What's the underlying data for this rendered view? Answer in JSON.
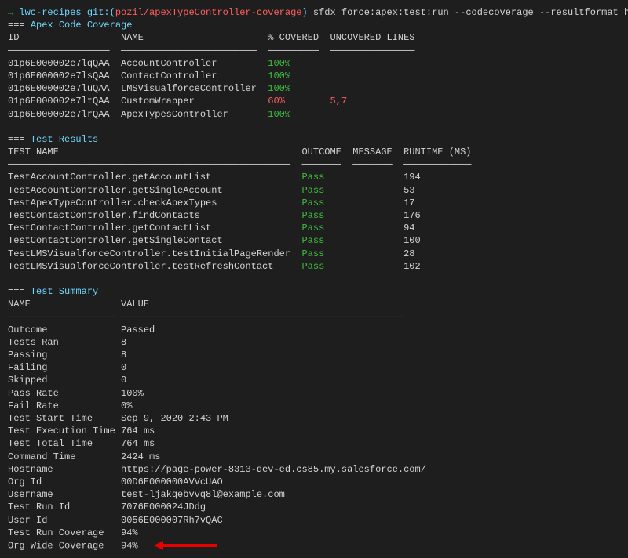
{
  "prompt": {
    "arrow": "→",
    "repo": "lwc-recipes",
    "git_label": "git:(",
    "branch": "pozil/apexTypeController-coverage",
    "close_paren": ")",
    "command": "sfdx force:apex:test:run --codecoverage --resultformat human"
  },
  "coverage": {
    "marker": "===",
    "title": "Apex Code Coverage",
    "headers": {
      "id": "ID",
      "name": "NAME",
      "covered": "% COVERED",
      "uncovered": "UNCOVERED LINES"
    },
    "rows": [
      {
        "id": "01p6E000002e7lqQAA",
        "name": "AccountController",
        "covered": "100%",
        "uncovered": "",
        "cls": "green"
      },
      {
        "id": "01p6E000002e7lsQAA",
        "name": "ContactController",
        "covered": "100%",
        "uncovered": "",
        "cls": "green"
      },
      {
        "id": "01p6E000002e7luQAA",
        "name": "LMSVisualforceController",
        "covered": "100%",
        "uncovered": "",
        "cls": "green"
      },
      {
        "id": "01p6E000002e7ltQAA",
        "name": "CustomWrapper",
        "covered": "60%",
        "uncovered": "5,7",
        "cls": "red"
      },
      {
        "id": "01p6E000002e7lrQAA",
        "name": "ApexTypesController",
        "covered": "100%",
        "uncovered": "",
        "cls": "green"
      }
    ]
  },
  "results": {
    "marker": "===",
    "title": "Test Results",
    "headers": {
      "name": "TEST NAME",
      "outcome": "OUTCOME",
      "message": "MESSAGE",
      "runtime": "RUNTIME (MS)"
    },
    "rows": [
      {
        "name": "TestAccountController.getAccountList",
        "outcome": "Pass",
        "runtime": "194"
      },
      {
        "name": "TestAccountController.getSingleAccount",
        "outcome": "Pass",
        "runtime": "53"
      },
      {
        "name": "TestApexTypeController.checkApexTypes",
        "outcome": "Pass",
        "runtime": "17"
      },
      {
        "name": "TestContactController.findContacts",
        "outcome": "Pass",
        "runtime": "176"
      },
      {
        "name": "TestContactController.getContactList",
        "outcome": "Pass",
        "runtime": "94"
      },
      {
        "name": "TestContactController.getSingleContact",
        "outcome": "Pass",
        "runtime": "100"
      },
      {
        "name": "TestLMSVisualforceController.testInitialPageRender",
        "outcome": "Pass",
        "runtime": "28"
      },
      {
        "name": "TestLMSVisualforceController.testRefreshContact",
        "outcome": "Pass",
        "runtime": "102"
      }
    ]
  },
  "summary": {
    "marker": "===",
    "title": "Test Summary",
    "headers": {
      "name": "NAME",
      "value": "VALUE"
    },
    "rows": [
      {
        "name": "Outcome",
        "value": "Passed"
      },
      {
        "name": "Tests Ran",
        "value": "8"
      },
      {
        "name": "Passing",
        "value": "8"
      },
      {
        "name": "Failing",
        "value": "0"
      },
      {
        "name": "Skipped",
        "value": "0"
      },
      {
        "name": "Pass Rate",
        "value": "100%"
      },
      {
        "name": "Fail Rate",
        "value": "0%"
      },
      {
        "name": "Test Start Time",
        "value": "Sep 9, 2020 2:43 PM"
      },
      {
        "name": "Test Execution Time",
        "value": "764 ms"
      },
      {
        "name": "Test Total Time",
        "value": "764 ms"
      },
      {
        "name": "Command Time",
        "value": "2424 ms"
      },
      {
        "name": "Hostname",
        "value": "https://page-power-8313-dev-ed.cs85.my.salesforce.com/"
      },
      {
        "name": "Org Id",
        "value": "00D6E000000AVVcUAO"
      },
      {
        "name": "Username",
        "value": "test-ljakqebvvq8l@example.com"
      },
      {
        "name": "Test Run Id",
        "value": "7076E000024JDdg"
      },
      {
        "name": "User Id",
        "value": "0056E000007Rh7vQAC"
      },
      {
        "name": "Test Run Coverage",
        "value": "94%"
      },
      {
        "name": "Org Wide Coverage",
        "value": "94%",
        "arrow": true
      }
    ]
  }
}
